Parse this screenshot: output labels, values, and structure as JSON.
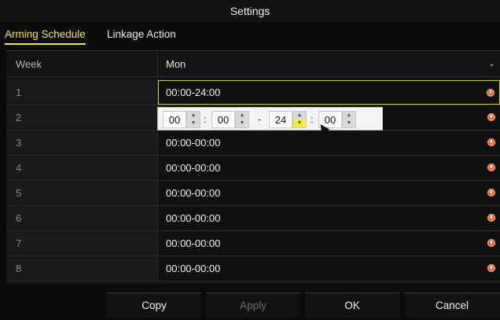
{
  "window": {
    "title": "Settings"
  },
  "tabs": [
    {
      "label": "Arming Schedule",
      "active": true
    },
    {
      "label": "Linkage Action",
      "active": false
    }
  ],
  "table": {
    "header": {
      "left": "Week",
      "right": "Mon"
    },
    "rows": [
      {
        "left": "1",
        "right": "00:00-24:00",
        "active": true
      },
      {
        "left": "2",
        "right": ""
      },
      {
        "left": "3",
        "right": "00:00-00:00"
      },
      {
        "left": "4",
        "right": "00:00-00:00"
      },
      {
        "left": "5",
        "right": "00:00-00:00"
      },
      {
        "left": "6",
        "right": "00:00-00:00"
      },
      {
        "left": "7",
        "right": "00:00-00:00"
      },
      {
        "left": "8",
        "right": "00:00-00:00"
      }
    ]
  },
  "popup": {
    "start_hour": "00",
    "start_min": "00",
    "end_hour": "24",
    "end_min": "00",
    "colon": ":",
    "dash": "-"
  },
  "buttons": {
    "copy": "Copy",
    "apply": "Apply",
    "ok": "OK",
    "cancel": "Cancel"
  },
  "icons": {
    "clock": "clock-icon",
    "dropdown": "chevron-down-icon"
  },
  "colors": {
    "accent": "#f4e640",
    "clock": "#f26c3a",
    "highlight": "#f3ef3a"
  }
}
